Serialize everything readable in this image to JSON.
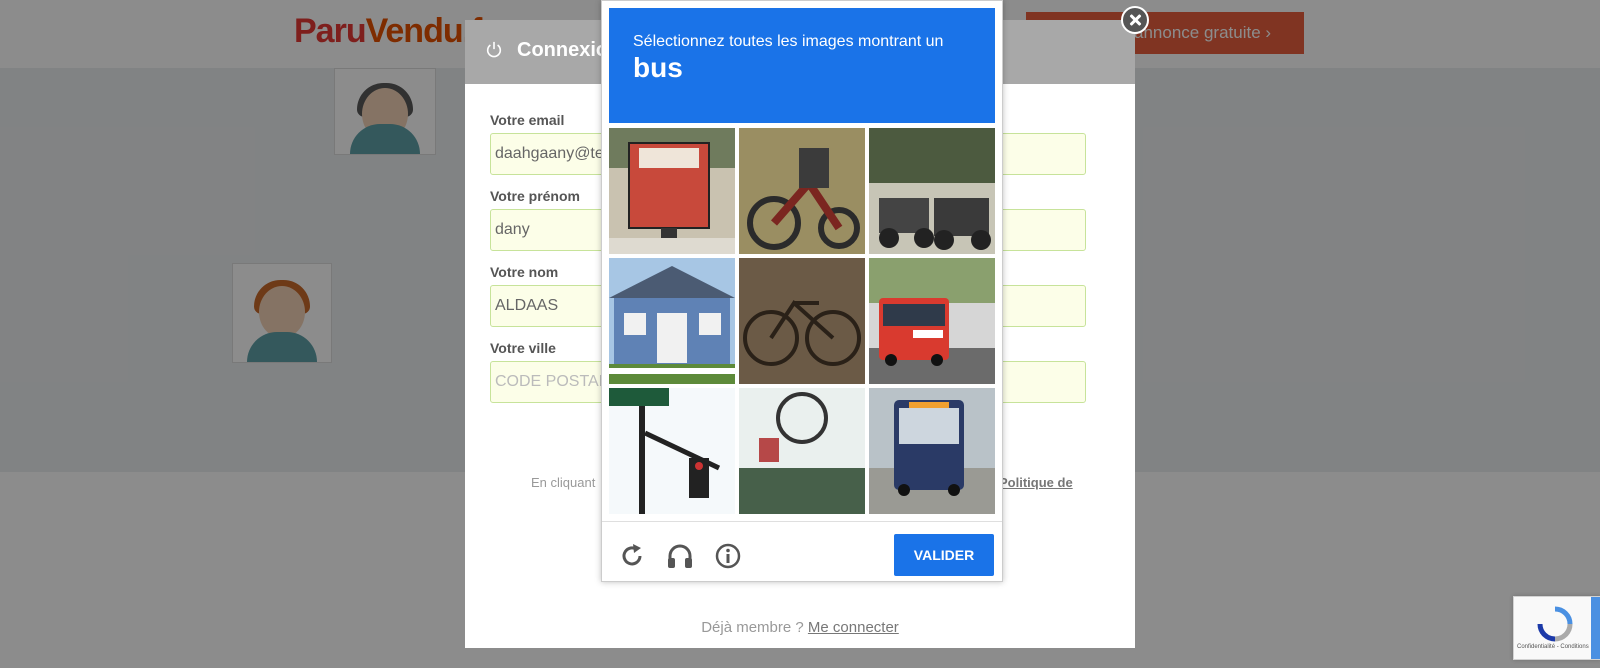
{
  "brand": {
    "logo_part1": "Paru",
    "logo_part2": "Vendu.f"
  },
  "header": {
    "cta_label": "annonce gratuite"
  },
  "modal": {
    "title": "Connexio",
    "fields": [
      {
        "label": "Votre email",
        "value": "daahgaany@te"
      },
      {
        "label": "Votre prénom",
        "value": "dany"
      },
      {
        "label": "Votre nom",
        "value": "ALDAAS"
      },
      {
        "label": "Votre ville",
        "placeholder": "CODE POSTAL"
      }
    ],
    "legal_left": "En cliquant",
    "legal_right": "Politique de",
    "member_text": "Déjà membre ?",
    "member_link": "Me connecter"
  },
  "captcha": {
    "instruction": "Sélectionnez toutes les images montrant un",
    "target": "bus",
    "tiles": [
      "red-mailbox",
      "motorcycle",
      "atvs-in-forest",
      "house",
      "bicycle",
      "red-bus",
      "traffic-light",
      "traffic-sign",
      "city-bus"
    ],
    "footer": {
      "reload_icon": "reload-icon",
      "audio_icon": "headphones-icon",
      "info_icon": "info-icon",
      "verify_label": "VALIDER"
    }
  },
  "badge": {
    "text": "Confidentialité - Conditions"
  },
  "colors": {
    "captcha_blue": "#1a73e8",
    "cta_orange": "#e9603f",
    "logo_red": "#e53935"
  }
}
